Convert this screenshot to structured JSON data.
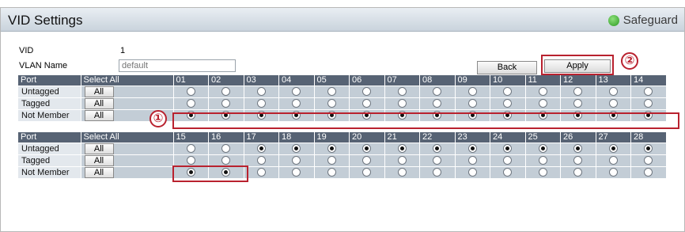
{
  "header": {
    "title": "VID Settings",
    "safeguard_label": "Safeguard",
    "safeguard_color": "#3aa52e"
  },
  "form": {
    "vid_label": "VID",
    "vid_value": "1",
    "vlan_name_label": "VLAN Name",
    "vlan_name_placeholder": "default"
  },
  "buttons": {
    "back": "Back",
    "apply": "Apply",
    "all": "All"
  },
  "table": {
    "port_header": "Port",
    "select_all_header": "Select All",
    "row_labels": [
      "Untagged",
      "Tagged",
      "Not Member"
    ],
    "groups": [
      {
        "ports": [
          "01",
          "02",
          "03",
          "04",
          "05",
          "06",
          "07",
          "08",
          "09",
          "10",
          "11",
          "12",
          "13",
          "14"
        ],
        "selected": [
          "Not Member",
          "Not Member",
          "Not Member",
          "Not Member",
          "Not Member",
          "Not Member",
          "Not Member",
          "Not Member",
          "Not Member",
          "Not Member",
          "Not Member",
          "Not Member",
          "Not Member",
          "Not Member"
        ]
      },
      {
        "ports": [
          "15",
          "16",
          "17",
          "18",
          "19",
          "20",
          "21",
          "22",
          "23",
          "24",
          "25",
          "26",
          "27",
          "28"
        ],
        "selected": [
          "Not Member",
          "Not Member",
          "Untagged",
          "Untagged",
          "Untagged",
          "Untagged",
          "Untagged",
          "Untagged",
          "Untagged",
          "Untagged",
          "Untagged",
          "Untagged",
          "Untagged",
          "Untagged"
        ]
      }
    ]
  },
  "annotations": {
    "marker_1": "①",
    "marker_2": "②",
    "highlight_color": "#b9222f"
  }
}
